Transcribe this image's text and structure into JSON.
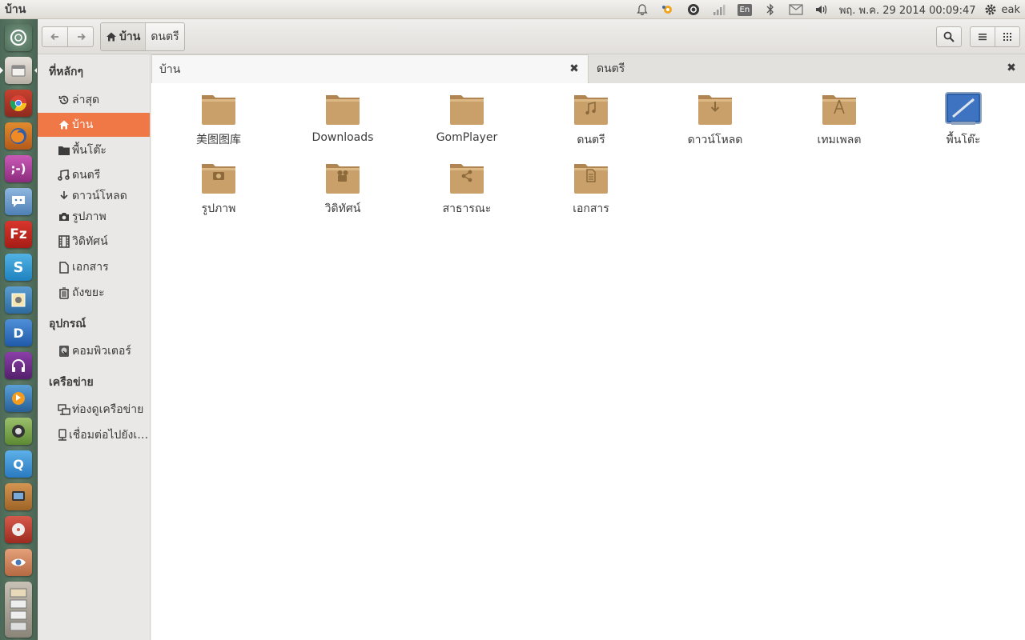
{
  "window": {
    "title": "บ้าน"
  },
  "panel": {
    "indicators": [
      "bell-icon",
      "weather-icon",
      "ubuntu-one-icon",
      "signal-icon",
      "keyboard-layout-icon",
      "bluetooth-icon",
      "mail-icon",
      "volume-icon"
    ],
    "keyboard_layout": "En",
    "clock": "พฤ. พ.ค. 29 2014 00:09:47",
    "user": "eak"
  },
  "launcher": {
    "items": [
      "dash-home",
      "files",
      "chrome",
      "firefox",
      "empathy",
      "pidgin",
      "filezilla",
      "skype",
      "shotwell",
      "deadbeef",
      "headphones",
      "clementine",
      "system-monitor",
      "qbittorrent",
      "tv",
      "disc-burner",
      "eye-of-gnome",
      "stacked-apps"
    ]
  },
  "header": {
    "path": [
      "บ้าน",
      "ดนตรี"
    ]
  },
  "sidebar": {
    "sections": {
      "places": "ที่หลักๆ",
      "devices": "อุปกรณ์",
      "network": "เครือข่าย"
    },
    "places": [
      {
        "label": "ล่าสุด",
        "icon": "recent-icon"
      },
      {
        "label": "บ้าน",
        "icon": "home-icon",
        "selected": true
      },
      {
        "label": "พื้นโต๊ะ",
        "icon": "desktop-folder-icon"
      },
      {
        "label": "ดนตรี",
        "icon": "music-icon"
      },
      {
        "label": "ดาวน์โหลด",
        "icon": "download-icon"
      },
      {
        "label": "รูปภาพ",
        "icon": "camera-icon"
      },
      {
        "label": "วิดิทัศน์",
        "icon": "film-icon"
      },
      {
        "label": "เอกสาร",
        "icon": "document-icon"
      },
      {
        "label": "ถังขยะ",
        "icon": "trash-icon"
      }
    ],
    "devices": [
      {
        "label": "คอมพิวเตอร์",
        "icon": "harddisk-icon"
      }
    ],
    "network": [
      {
        "label": "ท่องดูเครือข่าย",
        "icon": "network-icon"
      },
      {
        "label": "เชื่อมต่อไปยังเซิร์ฟเวอร์",
        "icon": "server-icon"
      }
    ]
  },
  "tabs": [
    {
      "label": "บ้าน",
      "active": true
    },
    {
      "label": "ดนตรี",
      "active": false
    }
  ],
  "files": [
    {
      "name": "美图图库",
      "icon": "folder-icon"
    },
    {
      "name": "Downloads",
      "icon": "folder-icon"
    },
    {
      "name": "GomPlayer",
      "icon": "folder-icon"
    },
    {
      "name": "ดนตรี",
      "icon": "music-folder-icon"
    },
    {
      "name": "ดาวน์โหลด",
      "icon": "download-folder-icon"
    },
    {
      "name": "เทมเพลต",
      "icon": "templates-folder-icon"
    },
    {
      "name": "พื้นโต๊ะ",
      "icon": "desktop-folder-icon"
    },
    {
      "name": "รูปภาพ",
      "icon": "pictures-folder-icon"
    },
    {
      "name": "วิดิทัศน์",
      "icon": "videos-folder-icon"
    },
    {
      "name": "สาธารณะ",
      "icon": "public-folder-icon"
    },
    {
      "name": "เอกสาร",
      "icon": "documents-folder-icon"
    }
  ],
  "colors": {
    "accent": "#f07746",
    "folder": "#c9a06a",
    "launcher": "#56735f"
  }
}
